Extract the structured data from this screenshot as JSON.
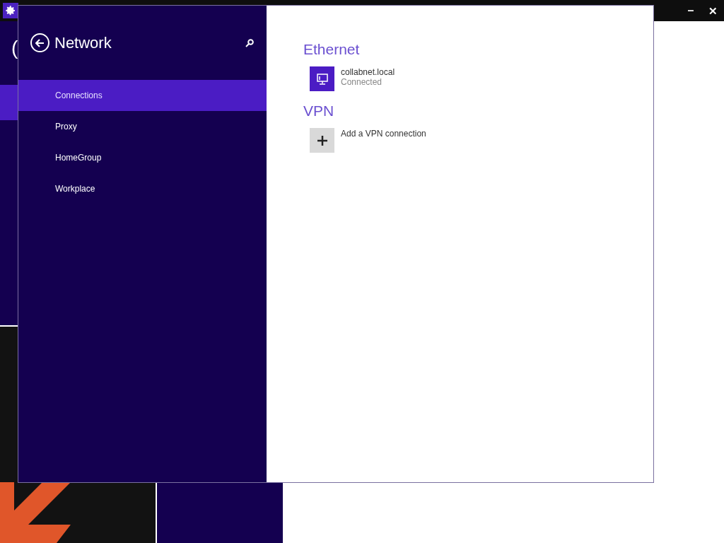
{
  "background": {
    "title_fragment": "("
  },
  "titlebar": {
    "minimize": "–",
    "close": "✕"
  },
  "sidebar": {
    "title": "Network",
    "items": [
      {
        "label": "Connections",
        "selected": true
      },
      {
        "label": "Proxy",
        "selected": false
      },
      {
        "label": "HomeGroup",
        "selected": false
      },
      {
        "label": "Workplace",
        "selected": false
      }
    ]
  },
  "sections": [
    {
      "heading": "Ethernet",
      "items": [
        {
          "kind": "network",
          "name": "collabnet.local",
          "status": "Connected"
        }
      ]
    },
    {
      "heading": "VPN",
      "items": [
        {
          "kind": "add",
          "name": "Add a VPN connection"
        }
      ]
    }
  ]
}
